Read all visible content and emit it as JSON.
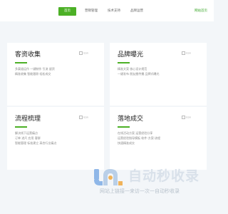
{
  "nav": {
    "items": [
      "首页",
      "营销管理",
      "技术支持",
      "品牌运营"
    ],
    "active_index": 0,
    "right_link": "网站首页"
  },
  "cards": [
    {
      "title": "客资收集",
      "image_alt": "icon",
      "lines": [
        "多渠道运作 一键制作 引流 留资",
        "精准收集 智能跟踪 轻松成交"
      ]
    },
    {
      "title": "品牌曝光",
      "image_alt": "icon",
      "lines": [
        "精准文案 核心设计规范",
        "一键发布 朋友圈传播 品牌式曝光"
      ]
    },
    {
      "title": "流程梳理",
      "image_alt": "icon",
      "lines": [
        "解决线下运营痛点",
        "订单 进尺 应用 客群",
        "智能管理 标准建立 高合行业痛点"
      ]
    },
    {
      "title": "落地成交",
      "image_alt": "icon",
      "lines": [
        "在线活动方案 运营经验分享",
        "运营经验指导模板 软件-方案-流程",
        "快速精准成交"
      ]
    }
  ],
  "watermark": {
    "title": "自动秒收录",
    "subtitle": "网站上链接一来访一次一自动秒收录"
  },
  "colors": {
    "accent": "#4cb026",
    "background": "#f3f6f9",
    "card": "#ffffff"
  }
}
